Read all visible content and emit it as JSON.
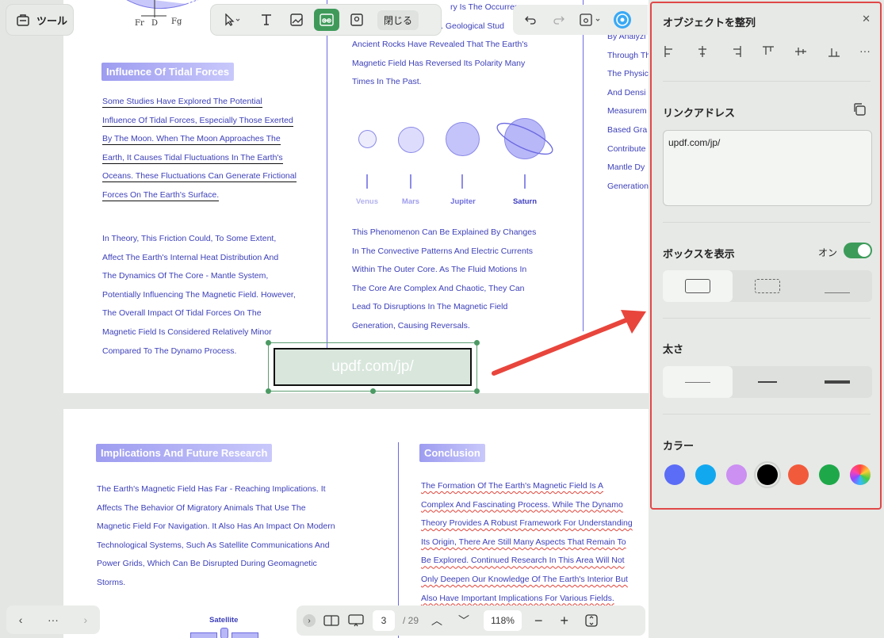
{
  "toolbar": {
    "tools_label": "ツール",
    "close_label": "閉じる"
  },
  "page1": {
    "figure_labels": [
      "Fr",
      "D",
      "Fg"
    ],
    "heading": "Influence Of Tidal Forces",
    "tidal_lines": [
      "Some Studies Have Explored The Potential",
      "Influence Of Tidal Forces, Especially Those Exerted",
      "By The Moon. When The Moon Approaches The",
      "Earth, It Causes Tidal Fluctuations In The Earth's",
      "Oceans. These Fluctuations Can Generate Frictional",
      "Forces On The Earth's Surface."
    ],
    "theory_lines": [
      " In Theory, This Friction Could, To Some Extent,",
      "Affect The Earth's Internal Heat Distribution And",
      "The Dynamics Of The Core - Mantle System,",
      "Potentially Influencing The Magnetic Field. However,",
      "The Overall Impact Of Tidal Forces On The",
      "Magnetic Field Is Considered Relatively Minor",
      "Compared To The Dynamo Process."
    ],
    "middle_top_lines": [
      "ry Is The Occurren",
      ". Geological Stud",
      "Ancient Rocks Have Revealed That The Earth's",
      "Magnetic Field Has Reversed Its Polarity Many",
      "Times In The Past."
    ],
    "planets": [
      "Venus",
      "Mars",
      "Jupiter",
      "Saturn"
    ],
    "middle_bottom_lines": [
      "This Phenomenon Can Be Explained By Changes",
      "In The Convective Patterns And Electric Currents",
      "Within The Outer Core. As The Fluid Motions In",
      "The Core Are Complex And Chaotic, They Can",
      "Lead To Disruptions In The Magnetic Field",
      "Generation, Causing Reversals."
    ],
    "right_lines": [
      "By Analyzi",
      "Through Th",
      "The Physic",
      "And Densi",
      "Measurem",
      "Based Gra",
      "Contribute",
      "Mantle Dy",
      "Generation"
    ],
    "link_box_text": "updf.com/jp/"
  },
  "page2": {
    "heading_left": "Implications And Future Research",
    "left_lines": [
      "The Earth's Magnetic Field Has Far - Reaching Implications. It",
      "Affects The Behavior Of Migratory Animals That Use The",
      "Magnetic Field For Navigation. It Also Has An Impact On Modern",
      "Technological Systems, Such As Satellite Communications And",
      "Power Grids, Which Can Be Disrupted During Geomagnetic",
      "Storms."
    ],
    "satellite_label": "Satellite",
    "heading_right": "Conclusion",
    "right_lines": [
      "The Formation Of The Earth's Magnetic Field Is A",
      "Complex And Fascinating Process. While The Dynamo",
      "Theory Provides A Robust Framework For Understanding",
      "Its Origin, There Are Still Many Aspects That Remain To",
      "Be Explored. Continued Research In This Area Will Not",
      "Only Deepen Our Knowledge Of The Earth's Interior But",
      "Also Have Important Implications For Various Fields."
    ]
  },
  "bottombar": {
    "current_page": "3",
    "total_pages": "/ 29",
    "zoom": "118%"
  },
  "panel": {
    "title": "オブジェクトを整列",
    "link_label": "リンクアドレス",
    "link_value": "updf.com/jp/",
    "box_label": "ボックスを表示",
    "toggle_label": "オン",
    "thickness_label": "太さ",
    "color_label": "カラー",
    "colors": [
      "#5b6cf6",
      "#12a8f0",
      "#cc8ff2",
      "#000000",
      "#f25a3c",
      "#1fa84a",
      "rainbow"
    ]
  }
}
